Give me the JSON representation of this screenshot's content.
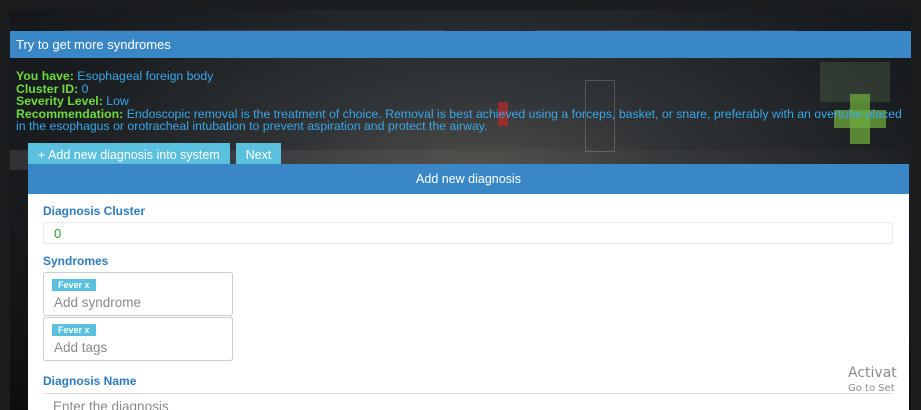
{
  "top_bar": {
    "title": "Try to get more syndromes"
  },
  "result": {
    "diagnosis_label": "You have:",
    "diagnosis_value": "Esophageal foreign body",
    "cluster_label": "Cluster ID:",
    "cluster_value": "0",
    "severity_label": "Severity Level:",
    "severity_value": "Low",
    "recommendation_label": "Recommendation:",
    "recommendation_value": "Endoscopic removal is the treatment of choice. Removal is best achieved using a forceps, basket, or snare, preferably with an overtube placed in the esophagus or orotracheal intubation to prevent aspiration and protect the airway."
  },
  "actions": {
    "add_label": "+ Add new diagnosis into system",
    "next_label": "Next"
  },
  "modal": {
    "title": "Add new diagnosis",
    "cluster_label": "Diagnosis Cluster",
    "cluster_value": "0",
    "syndromes_label": "Syndromes",
    "syndrome_chip": "Fever x",
    "syndrome_placeholder": "Add syndrome",
    "tag_chip": "Fever x",
    "tags_placeholder": "Add tags",
    "name_label": "Diagnosis Name",
    "name_placeholder": "Enter the diagnosis"
  },
  "watermark": {
    "line1": "Activat",
    "line2": "Go to Set"
  },
  "colors": {
    "bar_blue": "#3a87c7",
    "button_cyan": "#5bc0de",
    "label_green": "#6fdc3e",
    "value_blue": "#3aa7e8",
    "field_label_blue": "#2f7bbf"
  }
}
